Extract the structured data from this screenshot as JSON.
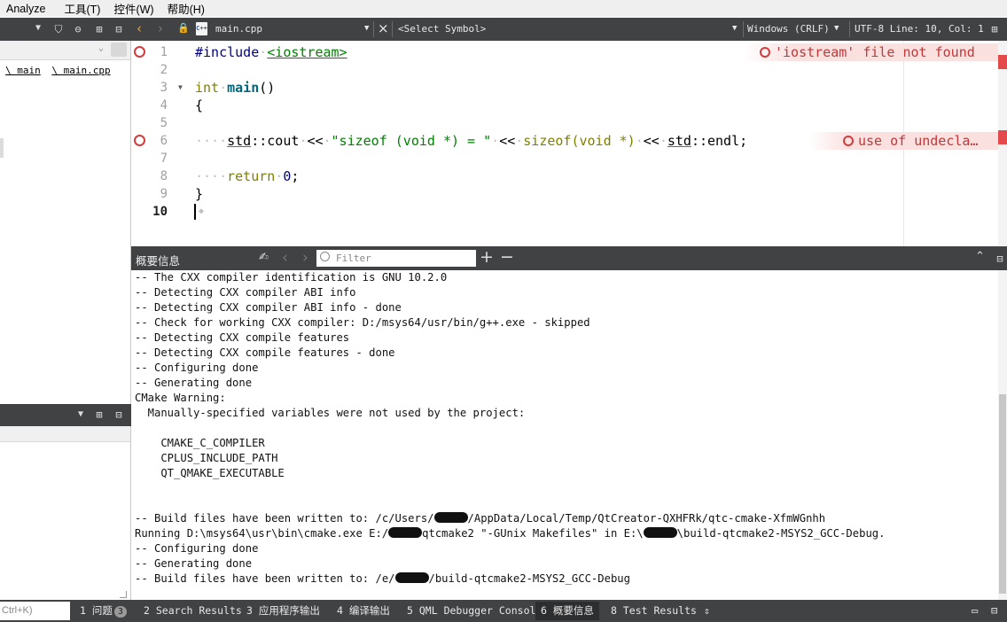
{
  "menu": [
    "Analyze",
    "工具(T)",
    "控件(W)",
    "帮助(H)"
  ],
  "sidebar": {
    "breadcrumbs": [
      "\\ main",
      "\\ main.cpp"
    ]
  },
  "toolbar": {
    "file_name": "main.cpp",
    "file_icon_text": "C++",
    "symbol_select": "<Select Symbol>",
    "line_ending": "Windows (CRLF)",
    "encoding_position": "UTF-8 Line: 10, Col: 1"
  },
  "editor": {
    "line_numbers": [
      "1",
      "2",
      "3",
      "4",
      "5",
      "6",
      "7",
      "8",
      "9",
      "10"
    ],
    "current_line": "10",
    "diagnostics": [
      {
        "line": "1",
        "message": "'iostream' file not found"
      },
      {
        "line": "6",
        "message": "use of undecla…"
      }
    ],
    "code": {
      "l1_directive": "#include",
      "l1_header": "<iostream>",
      "l3_type": "int",
      "l3_func": "main",
      "l3_parens": "()",
      "l4": "{",
      "l6_std1": "std",
      "l6_cout": "::cout",
      "l6_op1": "<<",
      "l6_str": "\"sizeof (void *) = \"",
      "l6_op2": "<<",
      "l6_sizeof": "sizeof",
      "l6_arg": "(void *)",
      "l6_op3": "<<",
      "l6_std2": "std",
      "l6_endl": "::endl;",
      "l8_kw": "return",
      "l8_num": "0",
      "l8_semi": ";",
      "l9": "}"
    }
  },
  "output_pane": {
    "title": "概要信息",
    "filter_placeholder": "Filter",
    "lines": [
      "-- The CXX compiler identification is GNU 10.2.0",
      "-- Detecting CXX compiler ABI info",
      "-- Detecting CXX compiler ABI info - done",
      "-- Check for working CXX compiler: D:/msys64/usr/bin/g++.exe - skipped",
      "-- Detecting CXX compile features",
      "-- Detecting CXX compile features - done",
      "-- Configuring done",
      "-- Generating done",
      "CMake Warning:",
      "  Manually-specified variables were not used by the project:",
      "",
      "    CMAKE_C_COMPILER",
      "    CPLUS_INCLUDE_PATH",
      "    QT_QMAKE_EXECUTABLE",
      "",
      ""
    ],
    "redacted_lines": {
      "r1": {
        "a": "-- Build files have been written to: /c/Users/",
        "b": "/AppData/Local/Temp/QtCreator-QXHFRk/qtc-cmake-XfmWGnhh"
      },
      "r2": {
        "a": "Running D:\\msys64\\usr\\bin\\cmake.exe E:/",
        "b": "qtcmake2 \"-GUnix Makefiles\" in E:\\",
        "c": "\\build-qtcmake2-MSYS2_GCC-Debug."
      },
      "r3": "-- Configuring done",
      "r4": "-- Generating done",
      "r5": {
        "a": "-- Build files have been written to: /e/",
        "b": "/build-qtcmake2-MSYS2_GCC-Debug"
      }
    }
  },
  "statusbar": {
    "locator_placeholder": "Ctrl+K)",
    "panes": [
      {
        "num": "1",
        "label": "问题",
        "badge": "3"
      },
      {
        "num": "2",
        "label": "Search Results"
      },
      {
        "num": "3",
        "label": "应用程序输出"
      },
      {
        "num": "4",
        "label": "编译输出"
      },
      {
        "num": "5",
        "label": "QML Debugger Console"
      },
      {
        "num": "6",
        "label": "概要信息"
      },
      {
        "num": "8",
        "label": "Test Results"
      }
    ]
  }
}
